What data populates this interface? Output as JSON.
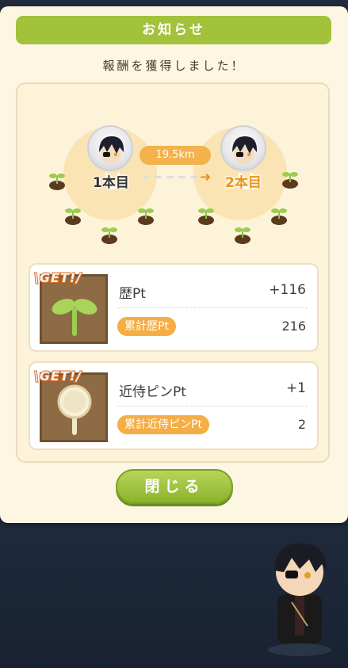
{
  "dialog": {
    "title": "お知らせ",
    "subtitle": "報酬を獲得しました！",
    "close_label": "閉じる"
  },
  "route": {
    "from_label": "1本目",
    "to_label": "2本目",
    "distance": "19.5km"
  },
  "rewards": [
    {
      "badge": "\\GET!/",
      "icon": "sprout-icon",
      "name": "歴Pt",
      "gain": "+116",
      "total_label": "累計歴Pt",
      "total_value": "216"
    },
    {
      "badge": "\\GET!/",
      "icon": "pin-icon",
      "name": "近侍ピンPt",
      "gain": "+1",
      "total_label": "累計近侍ピンPt",
      "total_value": "2"
    }
  ],
  "colors": {
    "accent_green": "#a2c23b",
    "accent_orange": "#f5ad45",
    "panel_bg": "#fdf6e3"
  }
}
